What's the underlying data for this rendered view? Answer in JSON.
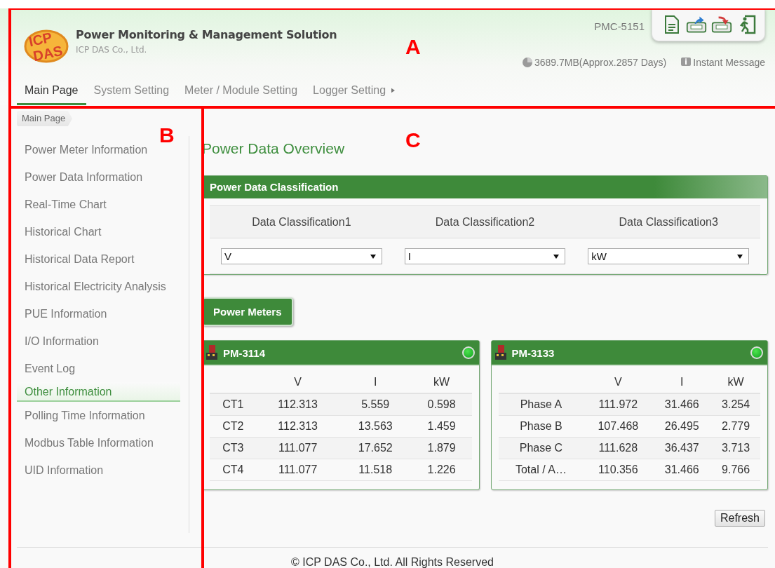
{
  "header": {
    "logo": {
      "line1": "ICP",
      "line2": "DAS"
    },
    "title": "Power Monitoring & Management Solution",
    "subtitle": "ICP DAS Co., Ltd.",
    "model": "PMC-5151",
    "storage": "3689.7MB(Approx.2857 Days)",
    "message_link": "Instant Message"
  },
  "nav_tabs": [
    {
      "label": "Main Page",
      "selected": true,
      "submenu": false
    },
    {
      "label": "System Setting",
      "selected": false,
      "submenu": false
    },
    {
      "label": "Meter / Module Setting",
      "selected": false,
      "submenu": false
    },
    {
      "label": "Logger Setting",
      "selected": false,
      "submenu": true
    }
  ],
  "breadcrumb": "Main Page",
  "sidebar": {
    "items": [
      {
        "label": "Power Meter Information",
        "selected": false
      },
      {
        "label": "Power Data Information",
        "selected": false
      },
      {
        "label": "Real-Time Chart",
        "selected": false
      },
      {
        "label": "Historical Chart",
        "selected": false
      },
      {
        "label": "Historical Data Report",
        "selected": false
      },
      {
        "label": "Historical Electricity Analysis",
        "selected": false
      },
      {
        "label": "PUE Information",
        "selected": false
      },
      {
        "label": "I/O Information",
        "selected": false
      },
      {
        "label": "Event Log",
        "selected": false
      },
      {
        "label": "Other Information",
        "selected": true
      },
      {
        "label": "Polling Time Information",
        "selected": false
      },
      {
        "label": "Modbus Table Information",
        "selected": false
      },
      {
        "label": "UID Information",
        "selected": false
      }
    ]
  },
  "page_title": "Power Data Overview",
  "classification_panel": {
    "title": "Power Data Classification",
    "columns": [
      {
        "heading": "Data Classification1",
        "value": "V"
      },
      {
        "heading": "Data Classification2",
        "value": "I"
      },
      {
        "heading": "Data Classification3",
        "value": "kW"
      }
    ]
  },
  "meters_button": "Power Meters",
  "meters": [
    {
      "name": "PM-3114",
      "online": true,
      "columns": [
        "",
        "V",
        "I",
        "kW"
      ],
      "rows": [
        [
          "CT1",
          "112.313",
          "5.559",
          "0.598"
        ],
        [
          "CT2",
          "112.313",
          "13.563",
          "1.459"
        ],
        [
          "CT3",
          "111.077",
          "17.652",
          "1.879"
        ],
        [
          "CT4",
          "111.077",
          "11.518",
          "1.226"
        ]
      ]
    },
    {
      "name": "PM-3133",
      "online": true,
      "columns": [
        "",
        "V",
        "I",
        "kW"
      ],
      "rows": [
        [
          "Phase A",
          "111.972",
          "31.466",
          "3.254"
        ],
        [
          "Phase B",
          "107.468",
          "26.495",
          "2.779"
        ],
        [
          "Phase C",
          "111.628",
          "36.437",
          "3.713"
        ],
        [
          "Total / A…",
          "110.356",
          "31.466",
          "9.766"
        ]
      ]
    }
  ],
  "refresh_button": "Refresh",
  "footer": "© ICP DAS Co., Ltd. All Rights Reserved",
  "annotations": [
    {
      "label": "A"
    },
    {
      "label": "B"
    },
    {
      "label": "C"
    }
  ]
}
